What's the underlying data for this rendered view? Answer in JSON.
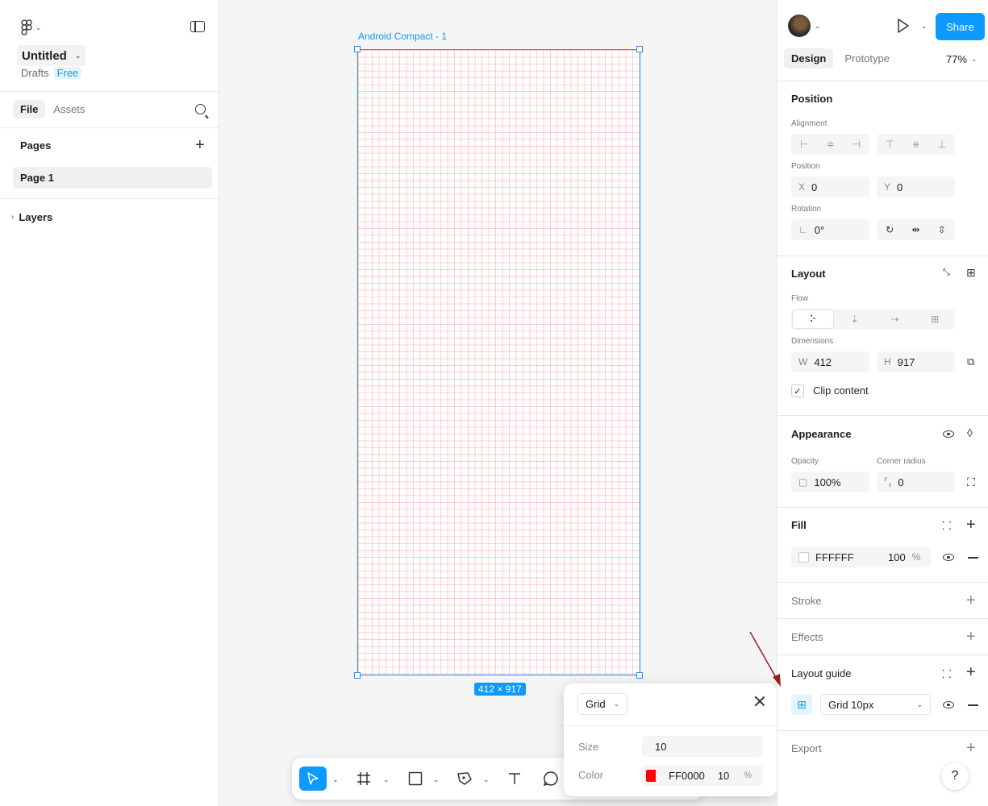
{
  "app": {
    "file_title": "Untitled",
    "location": "Drafts",
    "plan_badge": "Free"
  },
  "left_panel": {
    "tabs": [
      "File",
      "Assets"
    ],
    "pages_label": "Pages",
    "pages": [
      "Page 1"
    ],
    "layers_label": "Layers"
  },
  "canvas": {
    "frame_name": "Android Compact - 1",
    "frame_size_badge": "412 × 917"
  },
  "right_panel": {
    "tabs": [
      "Design",
      "Prototype"
    ],
    "zoom": "77%",
    "share_label": "Share",
    "position": {
      "title": "Position",
      "alignment_label": "Alignment",
      "position_label": "Position",
      "x_prefix": "X",
      "x": "0",
      "y_prefix": "Y",
      "y": "0",
      "rotation_label": "Rotation",
      "rotation": "0°"
    },
    "layout": {
      "title": "Layout",
      "flow_label": "Flow",
      "dimensions_label": "Dimensions",
      "w_prefix": "W",
      "w": "412",
      "h_prefix": "H",
      "h": "917",
      "clip_content_label": "Clip content",
      "clip_content": true
    },
    "appearance": {
      "title": "Appearance",
      "opacity_label": "Opacity",
      "opacity": "100%",
      "corner_radius_label": "Corner radius",
      "corner_radius": "0"
    },
    "fill": {
      "title": "Fill",
      "hex": "FFFFFF",
      "opacity": "100",
      "unit": "%"
    },
    "stroke_title": "Stroke",
    "effects_title": "Effects",
    "layout_guide": {
      "title": "Layout guide",
      "value": "Grid 10px"
    },
    "export_title": "Export",
    "help": "?"
  },
  "grid_popover": {
    "type": "Grid",
    "size_label": "Size",
    "size": "10",
    "color_label": "Color",
    "color_hex": "FF0000",
    "color_opacity": "10",
    "unit": "%"
  },
  "colors": {
    "accent": "#0d99ff",
    "grid_color": "#ff0000",
    "annotation_arrow": "#a11d1d"
  }
}
